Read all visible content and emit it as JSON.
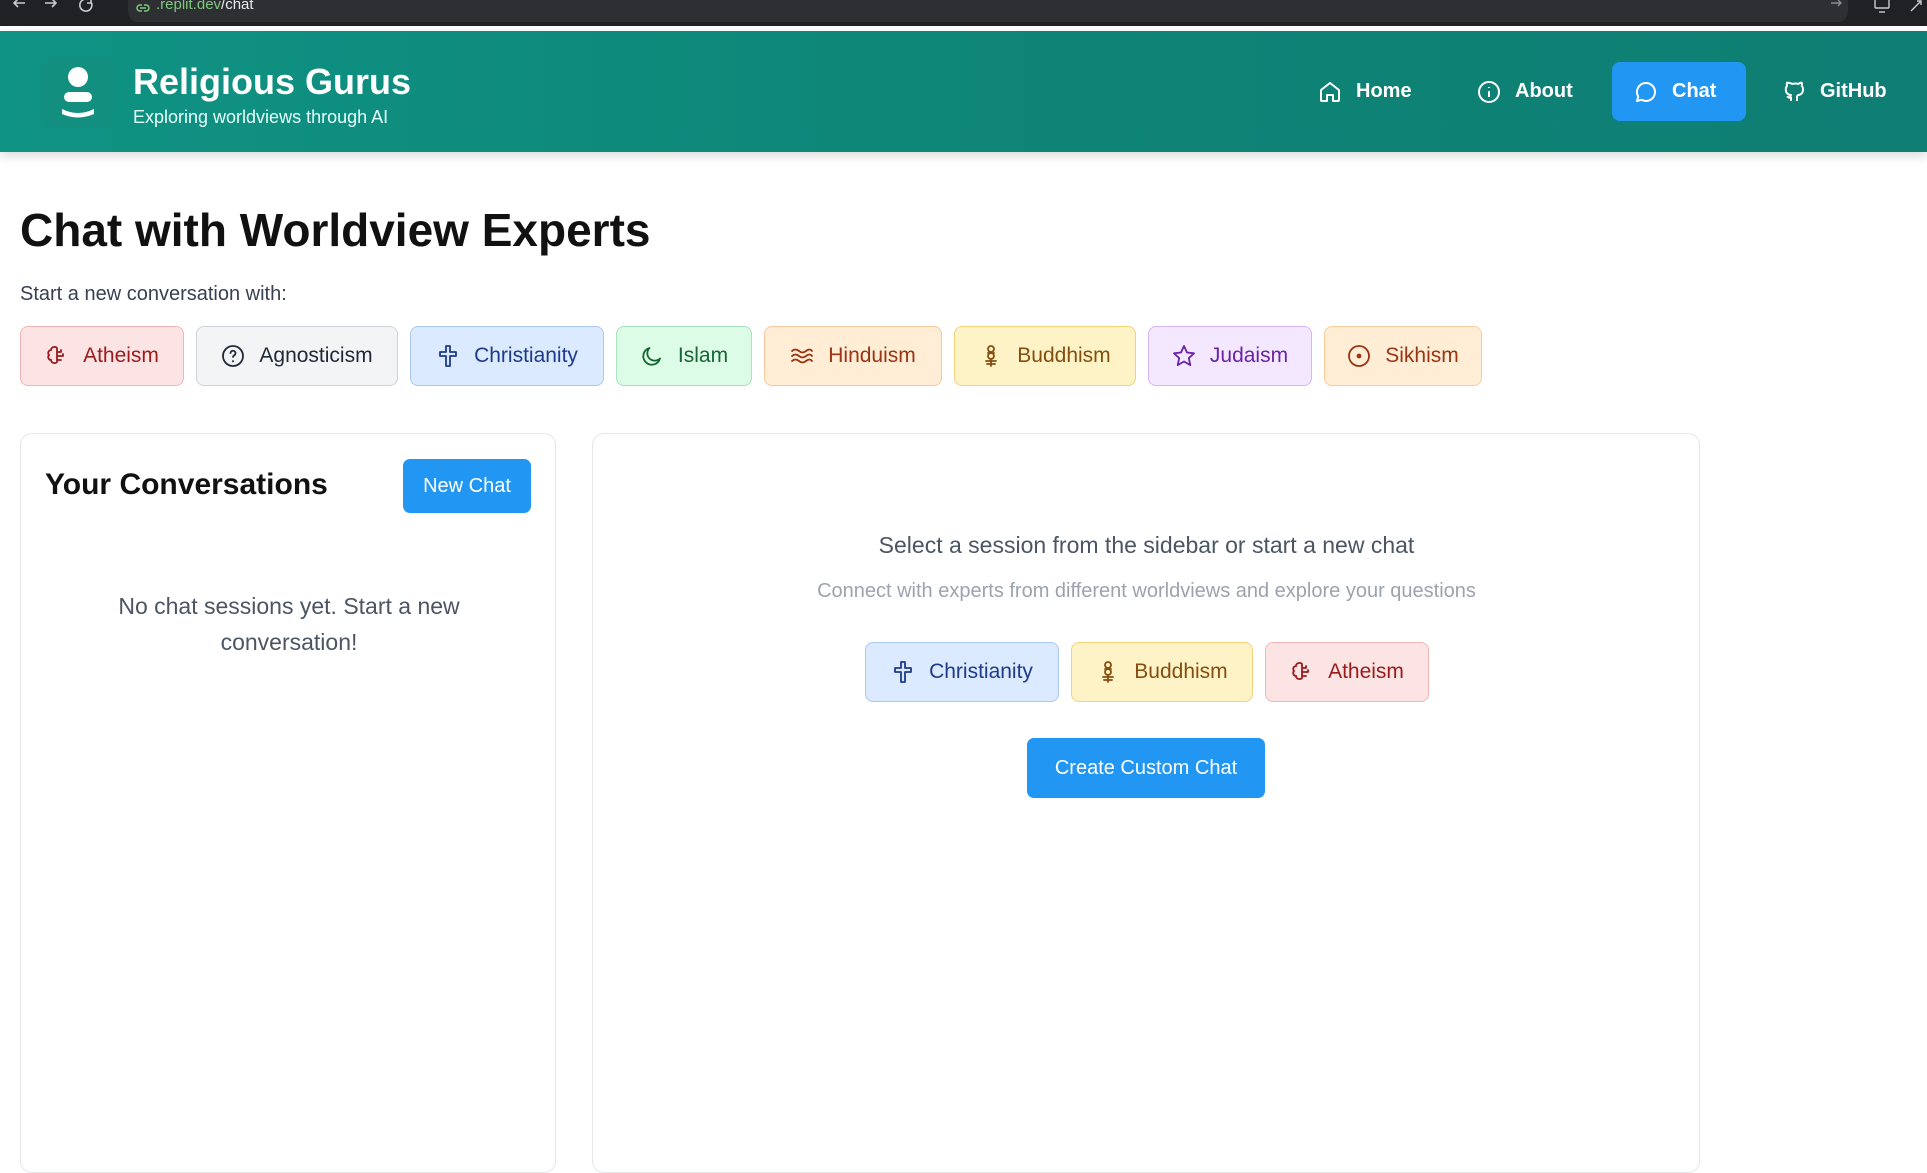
{
  "browser": {
    "url_domain": ".replit.dev",
    "url_path": "/chat"
  },
  "header": {
    "title": "Religious Gurus",
    "subtitle": "Exploring worldviews through AI",
    "nav": [
      {
        "label": "Home",
        "icon": "home-icon"
      },
      {
        "label": "About",
        "icon": "info-icon"
      },
      {
        "label": "Chat",
        "icon": "chat-icon",
        "active": true
      },
      {
        "label": "GitHub",
        "icon": "github-icon"
      }
    ]
  },
  "main": {
    "title": "Chat with Worldview Experts",
    "start_label": "Start a new conversation with:",
    "worldviews": [
      {
        "label": "Atheism",
        "icon": "brain-icon"
      },
      {
        "label": "Agnosticism",
        "icon": "question-circle-icon"
      },
      {
        "label": "Christianity",
        "icon": "cross-icon"
      },
      {
        "label": "Islam",
        "icon": "crescent-icon"
      },
      {
        "label": "Hinduism",
        "icon": "waves-icon"
      },
      {
        "label": "Buddhism",
        "icon": "lotus-icon"
      },
      {
        "label": "Judaism",
        "icon": "star-icon"
      },
      {
        "label": "Sikhism",
        "icon": "circle-dot-icon"
      }
    ]
  },
  "sidebar": {
    "title": "Your Conversations",
    "new_chat_label": "New Chat",
    "empty_text": "No chat sessions yet. Start a new conversation!"
  },
  "chat_area": {
    "heading": "Select a session from the sidebar or start a new chat",
    "subheading": "Connect with experts from different worldviews and explore your questions",
    "quick_starts": [
      {
        "label": "Christianity",
        "icon": "cross-icon"
      },
      {
        "label": "Buddhism",
        "icon": "lotus-icon"
      },
      {
        "label": "Atheism",
        "icon": "brain-icon"
      }
    ],
    "custom_chat_label": "Create Custom Chat"
  },
  "colors": {
    "header": "#0e8b7d",
    "primary": "#2196f3"
  }
}
